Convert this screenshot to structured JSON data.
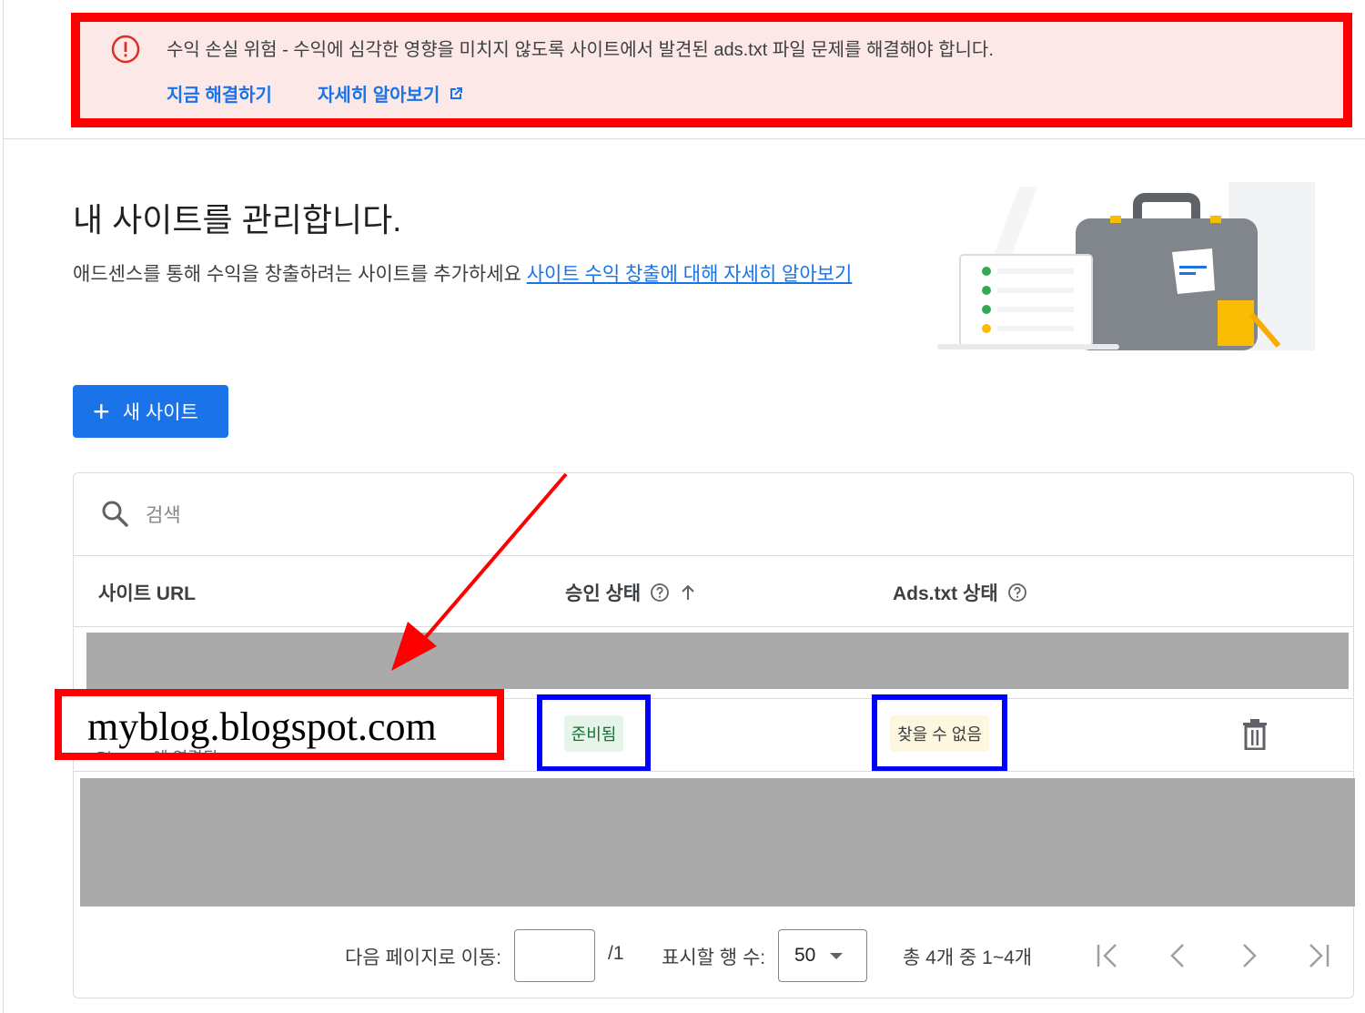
{
  "alert": {
    "message": "수익 손실 위험 - 수익에 심각한 영향을 미치지 않도록 사이트에서 발견된 ads.txt 파일 문제를 해결해야 합니다.",
    "fix_link": "지금 해결하기",
    "learn_link": "자세히 알아보기",
    "color": "#d93025"
  },
  "header": {
    "title": "내 사이트를 관리합니다.",
    "subtitle": "애드센스를 통해 수익을 창출하려는 사이트를 추가하세요",
    "subtitle_link": "사이트 수익 창출에 대해 자세히 알아보기"
  },
  "new_site_button": {
    "label": "새 사이트",
    "color": "#1a73e8"
  },
  "search": {
    "placeholder": "검색"
  },
  "table": {
    "columns": [
      "사이트 URL",
      "승인 상태",
      "Ads.txt 상태"
    ],
    "rows": [
      {
        "url": "myblog.blogspot.com",
        "sub": "Blogger에 연결됨",
        "approval_status": "준비됨",
        "ads_txt_status": "찾을 수 없음"
      }
    ]
  },
  "pagination": {
    "goto_label": "다음 페이지로 이동:",
    "page_input": "",
    "total_pages": "/1",
    "rows_label": "표시할 행 수:",
    "rows_value": "50",
    "range": "총 4개 중 1~4개"
  }
}
